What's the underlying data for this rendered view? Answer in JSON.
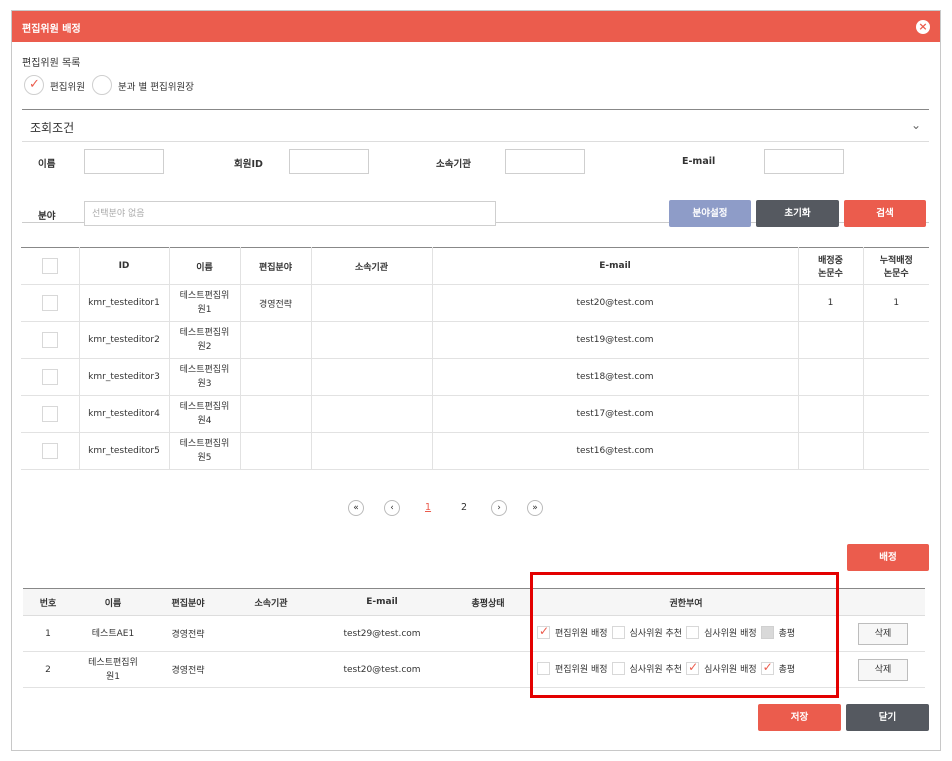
{
  "modal": {
    "title": "편집위원 배정",
    "close_icon": "×"
  },
  "list_label": "편집위원 목록",
  "radio_options": [
    {
      "label": "편집위원",
      "checked": true
    },
    {
      "label": "분과 별 편집위원장",
      "checked": false
    }
  ],
  "search": {
    "title": "조회조건",
    "labels": {
      "name": "이름",
      "member_id": "회원ID",
      "affiliation": "소속기관",
      "email": "E-mail",
      "field": "분야"
    },
    "field_placeholder": "선택분야 없음",
    "buttons": {
      "set_field": "분야설정",
      "reset": "초기화",
      "search": "검색"
    }
  },
  "editors_table": {
    "headers": [
      "ID",
      "이름",
      "편집분야",
      "소속기관",
      "E-mail",
      "배정중\n논문수",
      "누적배정\n논문수"
    ],
    "rows": [
      {
        "id": "kmr_testeditor1",
        "name": "테스트편집위\n원1",
        "field": "경영전략",
        "affiliation": "",
        "email": "test20@test.com",
        "assigned": "1",
        "cumulative": "1"
      },
      {
        "id": "kmr_testeditor2",
        "name": "테스트편집위\n원2",
        "field": "",
        "affiliation": "",
        "email": "test19@test.com",
        "assigned": "",
        "cumulative": ""
      },
      {
        "id": "kmr_testeditor3",
        "name": "테스트편집위\n원3",
        "field": "",
        "affiliation": "",
        "email": "test18@test.com",
        "assigned": "",
        "cumulative": ""
      },
      {
        "id": "kmr_testeditor4",
        "name": "테스트편집위\n원4",
        "field": "",
        "affiliation": "",
        "email": "test17@test.com",
        "assigned": "",
        "cumulative": ""
      },
      {
        "id": "kmr_testeditor5",
        "name": "테스트편집위\n원5",
        "field": "",
        "affiliation": "",
        "email": "test16@test.com",
        "assigned": "",
        "cumulative": ""
      }
    ]
  },
  "pagination": {
    "first": "«",
    "prev": "‹",
    "pages": [
      "1",
      "2"
    ],
    "current": "1",
    "next": "›",
    "last": "»"
  },
  "assign_button": "배정",
  "assigned_table": {
    "headers": [
      "번호",
      "이름",
      "편집분야",
      "소속기관",
      "E-mail",
      "총평상태",
      "권한부여",
      ""
    ],
    "rows": [
      {
        "no": "1",
        "name": "테스트AE1",
        "field": "경영전략",
        "affiliation": "",
        "email": "test29@test.com",
        "status": "",
        "perms": [
          {
            "label": "편집위원 배정",
            "checked": true,
            "disabled": false
          },
          {
            "label": "심사위원 추천",
            "checked": false,
            "disabled": false
          },
          {
            "label": "심사위원 배정",
            "checked": false,
            "disabled": false
          },
          {
            "label": "총평",
            "checked": false,
            "disabled": true
          }
        ],
        "delete_label": "삭제"
      },
      {
        "no": "2",
        "name": "테스트편집위\n원1",
        "field": "경영전략",
        "affiliation": "",
        "email": "test20@test.com",
        "status": "",
        "perms": [
          {
            "label": "편집위원 배정",
            "checked": false,
            "disabled": false
          },
          {
            "label": "심사위원 추천",
            "checked": false,
            "disabled": false
          },
          {
            "label": "심사위원 배정",
            "checked": true,
            "disabled": false
          },
          {
            "label": "총평",
            "checked": true,
            "disabled": false
          }
        ],
        "delete_label": "삭제"
      }
    ]
  },
  "footer": {
    "save": "저장",
    "close": "닫기"
  },
  "colors": {
    "accent": "#eb5c4d",
    "dark": "#555960",
    "blue": "#8e9cc8",
    "highlight": "#e30000"
  }
}
